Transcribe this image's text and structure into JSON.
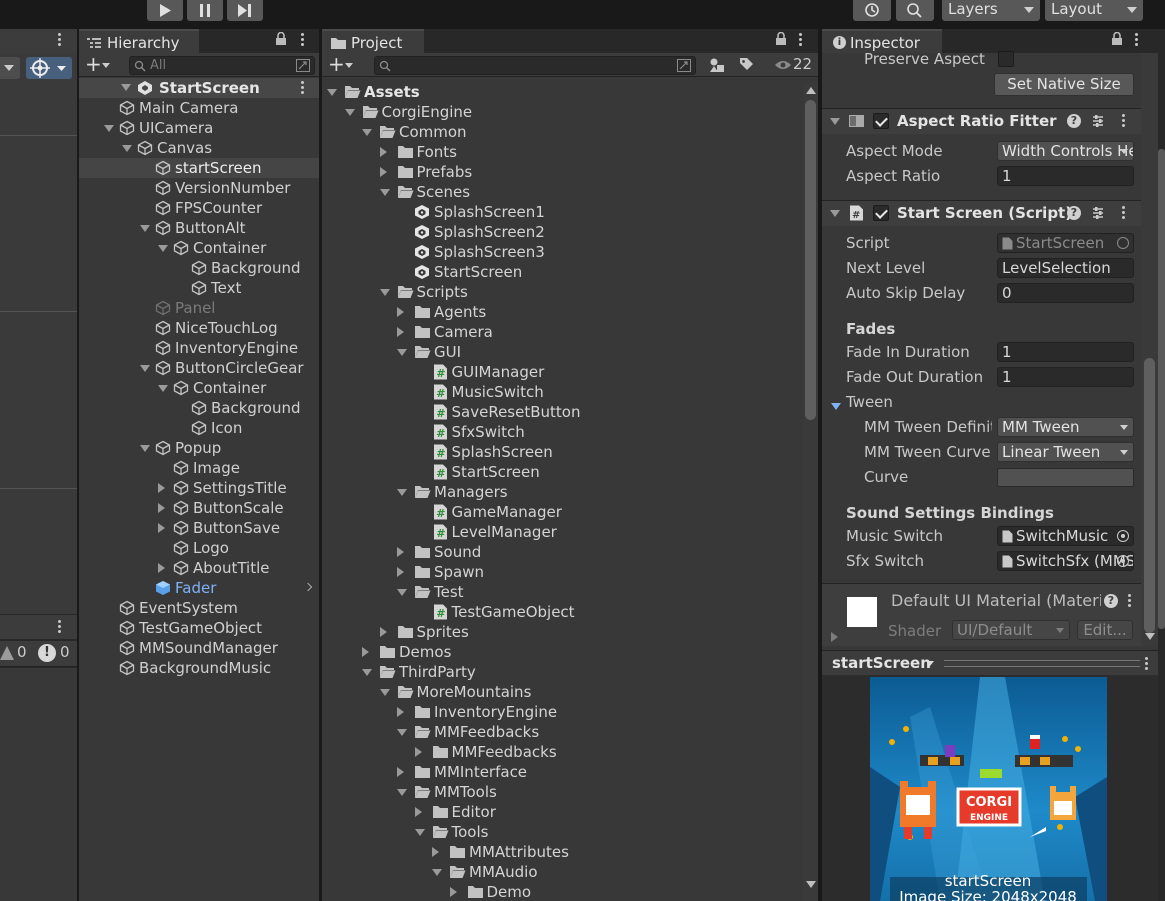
{
  "toolbar": {
    "layers_label": "Layers",
    "layout_label": "Layout"
  },
  "hierarchy": {
    "tab_label": "Hierarchy",
    "search_placeholder": "All",
    "scene_name": "StartScreen",
    "items": [
      {
        "label": "Main Camera",
        "depth": 1,
        "expand": "none",
        "style": "normal"
      },
      {
        "label": "UICamera",
        "depth": 1,
        "expand": "open",
        "style": "normal"
      },
      {
        "label": "Canvas",
        "depth": 2,
        "expand": "open",
        "style": "normal"
      },
      {
        "label": "startScreen",
        "depth": 3,
        "expand": "none",
        "style": "selected"
      },
      {
        "label": "VersionNumber",
        "depth": 3,
        "expand": "none",
        "style": "normal"
      },
      {
        "label": "FPSCounter",
        "depth": 3,
        "expand": "none",
        "style": "normal"
      },
      {
        "label": "ButtonAlt",
        "depth": 3,
        "expand": "open",
        "style": "normal"
      },
      {
        "label": "Container",
        "depth": 4,
        "expand": "open",
        "style": "normal"
      },
      {
        "label": "Background",
        "depth": 5,
        "expand": "none",
        "style": "normal"
      },
      {
        "label": "Text",
        "depth": 5,
        "expand": "none",
        "style": "normal"
      },
      {
        "label": "Panel",
        "depth": 3,
        "expand": "none",
        "style": "disabled"
      },
      {
        "label": "NiceTouchLog",
        "depth": 3,
        "expand": "none",
        "style": "normal"
      },
      {
        "label": "InventoryEngine",
        "depth": 3,
        "expand": "none",
        "style": "normal"
      },
      {
        "label": "ButtonCircleGear",
        "depth": 3,
        "expand": "open",
        "style": "normal"
      },
      {
        "label": "Container",
        "depth": 4,
        "expand": "open",
        "style": "normal"
      },
      {
        "label": "Background",
        "depth": 5,
        "expand": "none",
        "style": "normal"
      },
      {
        "label": "Icon",
        "depth": 5,
        "expand": "none",
        "style": "normal"
      },
      {
        "label": "Popup",
        "depth": 3,
        "expand": "open",
        "style": "normal"
      },
      {
        "label": "Image",
        "depth": 4,
        "expand": "none",
        "style": "normal"
      },
      {
        "label": "SettingsTitle",
        "depth": 4,
        "expand": "closed",
        "style": "normal"
      },
      {
        "label": "ButtonScale",
        "depth": 4,
        "expand": "closed",
        "style": "normal"
      },
      {
        "label": "ButtonSave",
        "depth": 4,
        "expand": "closed",
        "style": "normal"
      },
      {
        "label": "Logo",
        "depth": 4,
        "expand": "none",
        "style": "normal"
      },
      {
        "label": "AboutTitle",
        "depth": 4,
        "expand": "closed",
        "style": "normal"
      },
      {
        "label": "Fader",
        "depth": 3,
        "expand": "none",
        "style": "prefab"
      },
      {
        "label": "EventSystem",
        "depth": 1,
        "expand": "none",
        "style": "normal"
      },
      {
        "label": "TestGameObject",
        "depth": 1,
        "expand": "none",
        "style": "normal"
      },
      {
        "label": "MMSoundManager",
        "depth": 1,
        "expand": "none",
        "style": "normal"
      },
      {
        "label": "BackgroundMusic",
        "depth": 1,
        "expand": "none",
        "style": "normal"
      }
    ]
  },
  "console": {
    "warning_count": "0",
    "error_count": "0"
  },
  "project": {
    "tab_label": "Project",
    "hidden_count": "22",
    "tree": [
      {
        "label": "Assets",
        "depth": 0,
        "expand": "open",
        "kind": "folder",
        "bold": true
      },
      {
        "label": "CorgiEngine",
        "depth": 1,
        "expand": "open",
        "kind": "folder"
      },
      {
        "label": "Common",
        "depth": 2,
        "expand": "open",
        "kind": "folder"
      },
      {
        "label": "Fonts",
        "depth": 3,
        "expand": "closed",
        "kind": "folder"
      },
      {
        "label": "Prefabs",
        "depth": 3,
        "expand": "closed",
        "kind": "folder"
      },
      {
        "label": "Scenes",
        "depth": 3,
        "expand": "open",
        "kind": "folder"
      },
      {
        "label": "SplashScreen1",
        "depth": 4,
        "expand": "none",
        "kind": "scene"
      },
      {
        "label": "SplashScreen2",
        "depth": 4,
        "expand": "none",
        "kind": "scene"
      },
      {
        "label": "SplashScreen3",
        "depth": 4,
        "expand": "none",
        "kind": "scene"
      },
      {
        "label": "StartScreen",
        "depth": 4,
        "expand": "none",
        "kind": "scene"
      },
      {
        "label": "Scripts",
        "depth": 3,
        "expand": "open",
        "kind": "folder"
      },
      {
        "label": "Agents",
        "depth": 4,
        "expand": "closed",
        "kind": "folder"
      },
      {
        "label": "Camera",
        "depth": 4,
        "expand": "closed",
        "kind": "folder"
      },
      {
        "label": "GUI",
        "depth": 4,
        "expand": "open",
        "kind": "folder"
      },
      {
        "label": "GUIManager",
        "depth": 5,
        "expand": "none",
        "kind": "script"
      },
      {
        "label": "MusicSwitch",
        "depth": 5,
        "expand": "none",
        "kind": "script"
      },
      {
        "label": "SaveResetButton",
        "depth": 5,
        "expand": "none",
        "kind": "script"
      },
      {
        "label": "SfxSwitch",
        "depth": 5,
        "expand": "none",
        "kind": "script"
      },
      {
        "label": "SplashScreen",
        "depth": 5,
        "expand": "none",
        "kind": "script"
      },
      {
        "label": "StartScreen",
        "depth": 5,
        "expand": "none",
        "kind": "script"
      },
      {
        "label": "Managers",
        "depth": 4,
        "expand": "open",
        "kind": "folder"
      },
      {
        "label": "GameManager",
        "depth": 5,
        "expand": "none",
        "kind": "script"
      },
      {
        "label": "LevelManager",
        "depth": 5,
        "expand": "none",
        "kind": "script"
      },
      {
        "label": "Sound",
        "depth": 4,
        "expand": "closed",
        "kind": "folder"
      },
      {
        "label": "Spawn",
        "depth": 4,
        "expand": "closed",
        "kind": "folder"
      },
      {
        "label": "Test",
        "depth": 4,
        "expand": "open",
        "kind": "folder"
      },
      {
        "label": "TestGameObject",
        "depth": 5,
        "expand": "none",
        "kind": "script"
      },
      {
        "label": "Sprites",
        "depth": 3,
        "expand": "closed",
        "kind": "folder"
      },
      {
        "label": "Demos",
        "depth": 2,
        "expand": "closed",
        "kind": "folder"
      },
      {
        "label": "ThirdParty",
        "depth": 2,
        "expand": "open",
        "kind": "folder"
      },
      {
        "label": "MoreMountains",
        "depth": 3,
        "expand": "open",
        "kind": "folder"
      },
      {
        "label": "InventoryEngine",
        "depth": 4,
        "expand": "closed",
        "kind": "folder"
      },
      {
        "label": "MMFeedbacks",
        "depth": 4,
        "expand": "open",
        "kind": "folder"
      },
      {
        "label": "MMFeedbacks",
        "depth": 5,
        "expand": "closed",
        "kind": "folder"
      },
      {
        "label": "MMInterface",
        "depth": 4,
        "expand": "closed",
        "kind": "folder"
      },
      {
        "label": "MMTools",
        "depth": 4,
        "expand": "open",
        "kind": "folder"
      },
      {
        "label": "Editor",
        "depth": 5,
        "expand": "closed",
        "kind": "folder"
      },
      {
        "label": "Tools",
        "depth": 5,
        "expand": "open",
        "kind": "folder"
      },
      {
        "label": "MMAttributes",
        "depth": 6,
        "expand": "closed",
        "kind": "folder"
      },
      {
        "label": "MMAudio",
        "depth": 6,
        "expand": "open",
        "kind": "folder"
      },
      {
        "label": "Demo",
        "depth": 7,
        "expand": "closed",
        "kind": "folder"
      }
    ]
  },
  "inspector": {
    "tab_label": "Inspector",
    "preserve_aspect_label": "Preserve Aspect",
    "set_native_size_label": "Set Native Size",
    "aspect_ratio_fitter": {
      "title": "Aspect Ratio Fitter",
      "aspect_mode_label": "Aspect Mode",
      "aspect_mode_value": "Width Controls Height",
      "aspect_ratio_label": "Aspect Ratio",
      "aspect_ratio_value": "1"
    },
    "start_screen": {
      "title": "Start Screen (Script)",
      "script_label": "Script",
      "script_value": "StartScreen",
      "next_level_label": "Next Level",
      "next_level_value": "LevelSelection",
      "auto_skip_label": "Auto Skip Delay",
      "auto_skip_value": "0",
      "fades_header": "Fades",
      "fade_in_label": "Fade In Duration",
      "fade_in_value": "1",
      "fade_out_label": "Fade Out Duration",
      "fade_out_value": "1",
      "tween_label": "Tween",
      "tween_def_label": "MM Tween Definition",
      "tween_def_value": "MM Tween",
      "tween_curve_label": "MM Tween Curve",
      "tween_curve_value": "Linear Tween",
      "curve_label": "Curve",
      "bindings_header": "Sound Settings Bindings",
      "music_switch_label": "Music Switch",
      "music_switch_value": "SwitchMusic",
      "sfx_switch_label": "Sfx Switch",
      "sfx_switch_value": "SwitchSfx (MMSwitch)"
    },
    "material": {
      "title": "Default UI Material (Material)",
      "shader_label": "Shader",
      "shader_value": "UI/Default",
      "edit_label": "Edit..."
    },
    "preview": {
      "title": "startScreen",
      "image_name": "startScreen",
      "image_size": "Image Size: 2048x2048"
    }
  },
  "colors": {
    "panel_bg": "#383838",
    "selection": "#454545",
    "prefab_blue": "#7fb2f5",
    "sky_blue": "#1e8ac9"
  }
}
